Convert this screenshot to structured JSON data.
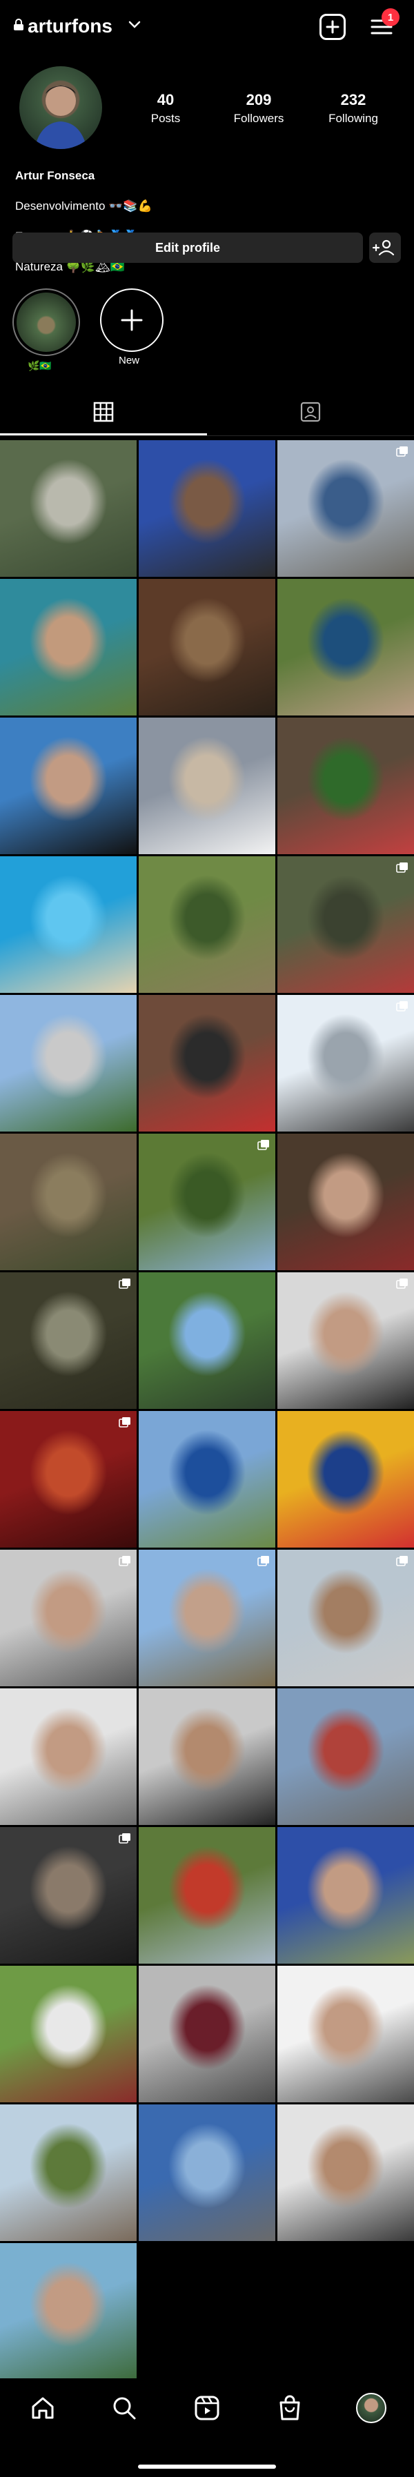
{
  "header": {
    "username": "arturfons",
    "notification_count": "1"
  },
  "profile": {
    "stats": [
      {
        "value": "40",
        "label": "Posts"
      },
      {
        "value": "209",
        "label": "Followers"
      },
      {
        "value": "232",
        "label": "Following"
      }
    ],
    "bio_lines": [
      "Artur Fonseca",
      "Desenvolvimento 👓📚💪",
      "Esportes 🏃⚽🚴🏅🥇",
      "Natureza 🌳🌿🏔🇧🇷"
    ],
    "edit_profile_label": "Edit profile"
  },
  "highlights": [
    {
      "label": "🌿🇧🇷"
    },
    {
      "label": "New"
    }
  ],
  "tabs": [
    "grid",
    "tagged"
  ],
  "grid": {
    "posts": [
      {
        "subject": "waterfall selfie",
        "colors": [
          "#5a6b4c",
          "#b9b9ad",
          "#3b4b33"
        ],
        "multi": false
      },
      {
        "subject": "couple selfie blue shirts",
        "colors": [
          "#2d4fa8",
          "#7a5a45",
          "#2a2a2a"
        ],
        "multi": false
      },
      {
        "subject": "runner with bib",
        "colors": [
          "#a9b6c6",
          "#3a5d8a",
          "#6d6a62"
        ],
        "multi": true
      },
      {
        "subject": "beach selfie",
        "colors": [
          "#2f8b9c",
          "#c29a7c",
          "#5d7f3a"
        ],
        "multi": false
      },
      {
        "subject": "couple in restaurant",
        "colors": [
          "#5c3b28",
          "#8a6a4a",
          "#2b2118"
        ],
        "multi": false
      },
      {
        "subject": "couple selfie outdoors",
        "colors": [
          "#5d7b3a",
          "#1d4f7c",
          "#b99c84"
        ],
        "multi": false
      },
      {
        "subject": "selfie indoors",
        "colors": [
          "#3d7fc2",
          "#c29b83",
          "#111"
        ],
        "multi": false
      },
      {
        "subject": "beach walking",
        "colors": [
          "#8b94a1",
          "#c7b8a4",
          "#f3f3f3"
        ],
        "multi": false
      },
      {
        "subject": "christmas tree",
        "colors": [
          "#5b4a3a",
          "#2f6a2a",
          "#c24040"
        ],
        "multi": false
      },
      {
        "subject": "pool",
        "colors": [
          "#22a0d9",
          "#5fc6f0",
          "#e6d3b0"
        ],
        "multi": false
      },
      {
        "subject": "hammock",
        "colors": [
          "#6f8a45",
          "#3d5a2a",
          "#8a7b5a"
        ],
        "multi": false
      },
      {
        "subject": "feet on rocks",
        "colors": [
          "#556042",
          "#3b4230",
          "#b43a3a"
        ],
        "multi": true
      },
      {
        "subject": "city street",
        "colors": [
          "#8fb6e0",
          "#c9c9c9",
          "#3d6b2c"
        ],
        "multi": false
      },
      {
        "subject": "motorcycle helmets",
        "colors": [
          "#6e4b3a",
          "#2b2b2b",
          "#c42f2f"
        ],
        "multi": false
      },
      {
        "subject": "mountain view",
        "colors": [
          "#e6eef5",
          "#9aa4ad",
          "#3b3b3b"
        ],
        "multi": true
      },
      {
        "subject": "forest",
        "colors": [
          "#6a5a45",
          "#8b7d5e",
          "#3d4a2c"
        ],
        "multi": false
      },
      {
        "subject": "tree trail",
        "colors": [
          "#5c7a35",
          "#3a5a25",
          "#8ab0d8"
        ],
        "multi": true
      },
      {
        "subject": "selfie guitar room",
        "colors": [
          "#4b3a2c",
          "#c29b83",
          "#8a2a2a"
        ],
        "multi": false
      },
      {
        "subject": "feet in stream",
        "colors": [
          "#3e3e2c",
          "#8a8a74",
          "#2b2b1e"
        ],
        "multi": true
      },
      {
        "subject": "palm plants",
        "colors": [
          "#4b7a3a",
          "#7fb0e0",
          "#2c3e2a"
        ],
        "multi": false
      },
      {
        "subject": "selfie glasses",
        "colors": [
          "#d8d8d8",
          "#c29b83",
          "#222"
        ],
        "multi": true
      },
      {
        "subject": "red fabric",
        "colors": [
          "#8a1a1a",
          "#c24b2b",
          "#3a0a0a"
        ],
        "multi": true
      },
      {
        "subject": "selfie landscape",
        "colors": [
          "#7aa6d6",
          "#1d4f9c",
          "#6b8a45"
        ],
        "multi": false
      },
      {
        "subject": "funko book",
        "colors": [
          "#e8b020",
          "#1c3f8a",
          "#d23030"
        ],
        "multi": false
      },
      {
        "subject": "selfie white shirt",
        "colors": [
          "#c9c9c9",
          "#c29b83",
          "#5a5a5a"
        ],
        "multi": true
      },
      {
        "subject": "church",
        "colors": [
          "#8ab4e0",
          "#c2a08a",
          "#7a6a4a"
        ],
        "multi": true
      },
      {
        "subject": "sunglasses selfie",
        "colors": [
          "#b9c6d0",
          "#a37e62",
          "#c9c9c9"
        ],
        "multi": true
      },
      {
        "subject": "glasses selfie",
        "colors": [
          "#e3e3e3",
          "#c29b83",
          "#6a6a6a"
        ],
        "multi": false
      },
      {
        "subject": "smiling selfie",
        "colors": [
          "#c9c9c9",
          "#b38a6e",
          "#222"
        ],
        "multi": false
      },
      {
        "subject": "race runners",
        "colors": [
          "#7f9cbd",
          "#b0423a",
          "#6b6b6b"
        ],
        "multi": false
      },
      {
        "subject": "motorcycles",
        "colors": [
          "#3a3a3a",
          "#8a7a6a",
          "#1a1a1a"
        ],
        "multi": true
      },
      {
        "subject": "race finish",
        "colors": [
          "#5d7a3a",
          "#c23a2a",
          "#a8b8c8"
        ],
        "multi": false
      },
      {
        "subject": "friends selfie",
        "colors": [
          "#2d4fa8",
          "#c29b83",
          "#8a9a5a"
        ],
        "multi": false
      },
      {
        "subject": "runner white shirt",
        "colors": [
          "#6e9b45",
          "#e8e8e8",
          "#8a2a2a"
        ],
        "multi": false
      },
      {
        "subject": "sunglasses portrait",
        "colors": [
          "#b8b8b8",
          "#6a1e2a",
          "#4a4a4a"
        ],
        "multi": false
      },
      {
        "subject": "three friends",
        "colors": [
          "#f2f2f2",
          "#c29b83",
          "#4a4a4a"
        ],
        "multi": false
      },
      {
        "subject": "hilltop view",
        "colors": [
          "#bcd0e0",
          "#5d7a3a",
          "#7a6a5a"
        ],
        "multi": false
      },
      {
        "subject": "rock sitting",
        "colors": [
          "#3a6ab0",
          "#8ab0d8",
          "#6a6a6a"
        ],
        "multi": false
      },
      {
        "subject": "sunglasses close",
        "colors": [
          "#e3e3e3",
          "#b38a6e",
          "#3a3a3a"
        ],
        "multi": false
      },
      {
        "subject": "outdoor selfie",
        "colors": [
          "#7ab0d0",
          "#c29b83",
          "#3d6a3a"
        ],
        "multi": false
      }
    ]
  },
  "nav": [
    "home-icon",
    "search-icon",
    "reels-icon",
    "shop-icon",
    "profile-avatar"
  ]
}
